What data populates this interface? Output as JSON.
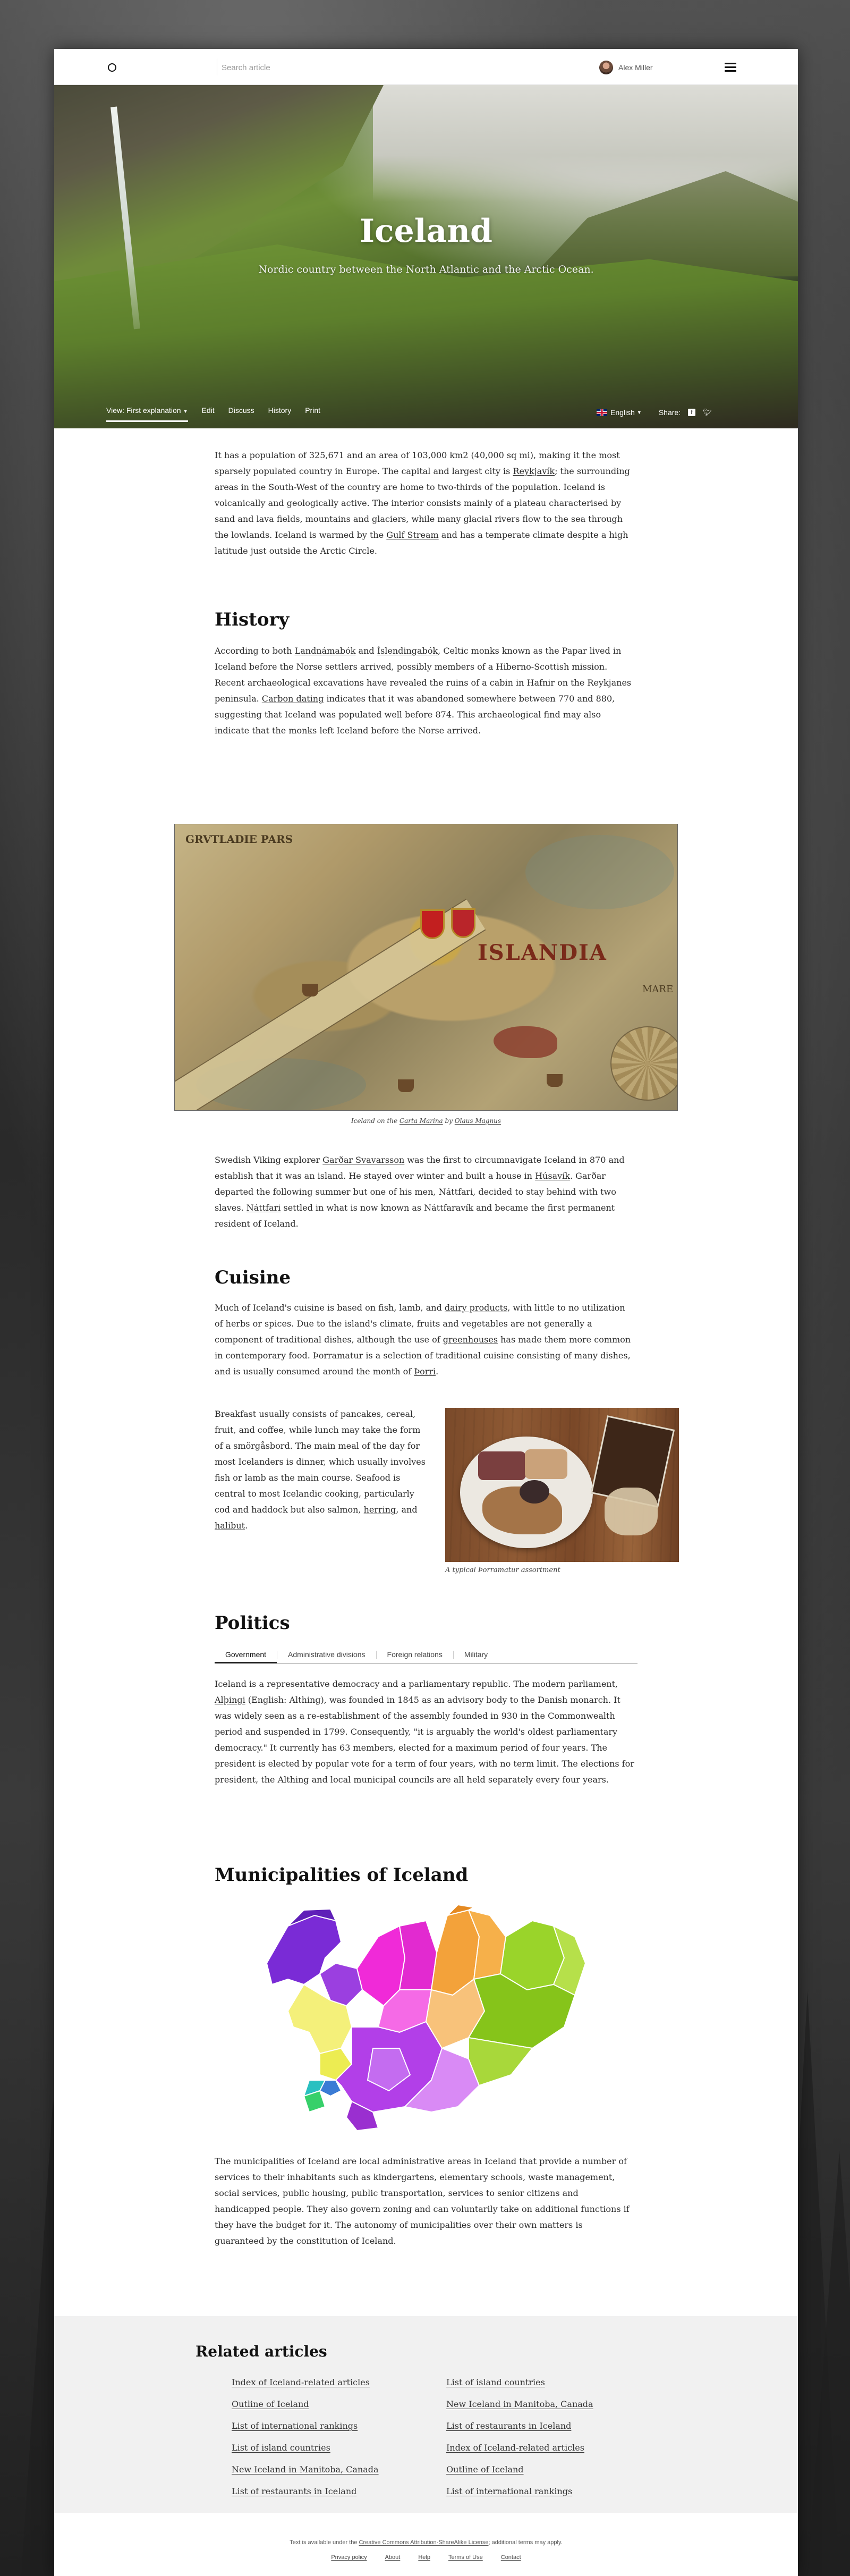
{
  "header": {
    "search_placeholder": "Search article",
    "user_name": "Alex Miller"
  },
  "hero": {
    "title": "Iceland",
    "subtitle": "Nordic country between the North Atlantic and the Arctic Ocean.",
    "tabs": [
      {
        "label": "View: First explanation",
        "has_caret": true
      },
      {
        "label": "Edit"
      },
      {
        "label": "Discuss"
      },
      {
        "label": "History"
      },
      {
        "label": "Print"
      }
    ],
    "language": "English",
    "share_label": "Share:"
  },
  "intro": {
    "p1_a": "It has a population of 325,671 and an area of 103,000 km2 (40,000 sq mi), making it the most sparsely populated country in Europe. The capital and largest city is ",
    "p1_link1": "Reykjavík",
    "p1_b": "; the surrounding areas in the South-West of the country are home to two-thirds of the population. Iceland is volcanically and geologically active. The interior consists mainly of a plateau characterised by sand and lava fields, mountains and glaciers, while many glacial rivers flow to the sea through the lowlands. Iceland is warmed by the ",
    "p1_link2": "Gulf Stream",
    "p1_c": " and has a temperate climate despite a high latitude just outside the Arctic Circle."
  },
  "history": {
    "heading": "History",
    "p1_a": "According to both ",
    "link1": "Landnámabók",
    "p1_b": " and ",
    "link2": "Íslendingabók",
    "p1_c": ", Celtic monks known as the Papar lived in Iceland before the Norse settlers arrived, possibly members of a Hiberno-Scottish mission. Recent archaeological excavations have revealed the ruins of a cabin in Hafnir on the Reykjanes peninsula. ",
    "link3": "Carbon dating",
    "p1_d": " indicates that it was abandoned somewhere between 770 and 880, suggesting that Iceland was populated well before 874. This archaeological find may also indicate that the monks left Iceland before the Norse arrived.",
    "map_labels": {
      "top_left": "GRVTLADIE PARS",
      "center": "ISLANDIA",
      "right": "MARE"
    },
    "caption_a": "Iceland on the ",
    "caption_link1": "Carta Marina",
    "caption_b": " by ",
    "caption_link2": "Olaus Magnus",
    "p2_a": "Swedish Viking explorer ",
    "p2_link1": "Garðar Svavarsson",
    "p2_b": " was the first to circumnavigate Iceland in 870 and establish that it was an island. He stayed over winter and built a house in ",
    "p2_link2": "Húsavík",
    "p2_c": ". Garðar departed the following summer but one of his men, Náttfari, decided to stay behind with two slaves. ",
    "p2_link3": "Náttfari",
    "p2_d": " settled in what is now known as Náttfaravík and became the first permanent resident of Iceland."
  },
  "cuisine": {
    "heading": "Cuisine",
    "p1_a": "Much of Iceland's cuisine is based on fish, lamb, and ",
    "link1": "dairy products",
    "p1_b": ", with little to no utilization of herbs or spices. Due to the island's climate, fruits and vegetables are not generally a component of traditional dishes, although the use of ",
    "link2": "greenhouses",
    "p1_c": " has made them more common in contemporary food. Þorramatur is a selection of traditional cuisine consisting of many dishes, and is usually consumed around the month of ",
    "link3": "Þorri",
    "p1_d": ".",
    "p2_a": "Breakfast usually consists of pancakes, cereal, fruit, and coffee, while lunch may take the form of a smörgåsbord. The main meal of the day for most Icelanders is dinner, which usually involves fish or lamb as the main course. Seafood is central to most Icelandic cooking, particularly cod and haddock but also salmon, ",
    "link4": "herring",
    "p2_b": ", and ",
    "link5": "halibut",
    "p2_c": ".",
    "image_caption": "A typical Þorramatur assortment"
  },
  "politics": {
    "heading": "Politics",
    "tabs": [
      "Government",
      "Administrative divisions",
      "Foreign relations",
      "Military"
    ],
    "active_tab": "Government",
    "p1_a": "Iceland is a representative democracy and a parliamentary republic. The modern parliament, ",
    "link1": "Alþingi",
    "p1_b": " (English: Althing), was founded in 1845 as an advisory body to the Danish monarch. It was widely seen as a re-establishment of the assembly founded in 930 in the Commonwealth period and suspended in 1799. Consequently, \"it is arguably the world's oldest parliamentary democracy.\" It currently has 63 members, elected for a maximum period of four years. The president is elected by popular vote for a term of four years, with no term limit. The elections for president, the Althing and local municipal councils are all held separately every four years."
  },
  "municipalities": {
    "heading": "Municipalities of Iceland",
    "p1": "The municipalities of Iceland are local administrative areas in Iceland that provide a number of services to their inhabitants such as kindergartens, elementary schools, waste management, social services, public housing, public transportation, services to senior citizens and handicapped people. They also govern zoning and can voluntarily take on additional functions if they have the budget for it. The autonomy of municipalities over their own matters is guaranteed by the constitution of Iceland."
  },
  "related": {
    "heading": "Related articles",
    "left": [
      "Index of Iceland-related articles",
      "Outline of Iceland",
      "List of international rankings",
      "List of island countries",
      "New Iceland in Manitoba, Canada",
      "List of restaurants in Iceland"
    ],
    "right": [
      "List of island countries",
      "New Iceland in Manitoba, Canada",
      "List of restaurants in Iceland",
      "Index of Iceland-related articles",
      "Outline of Iceland",
      "List of international rankings"
    ]
  },
  "footer": {
    "note_a": "Text is available under the ",
    "note_link": "Creative Commons Attribution-ShareAlike License",
    "note_b": "; additional terms may apply.",
    "links": [
      "Privacy policy",
      "About",
      "Help",
      "Terms of Use",
      "Contact"
    ]
  },
  "colors": {
    "muni_purple": "#7a2bd6",
    "muni_magenta": "#f02ad8",
    "muni_orange": "#f3a23a",
    "muni_lime": "#9ad42a",
    "muni_yellow": "#f4f07a"
  }
}
